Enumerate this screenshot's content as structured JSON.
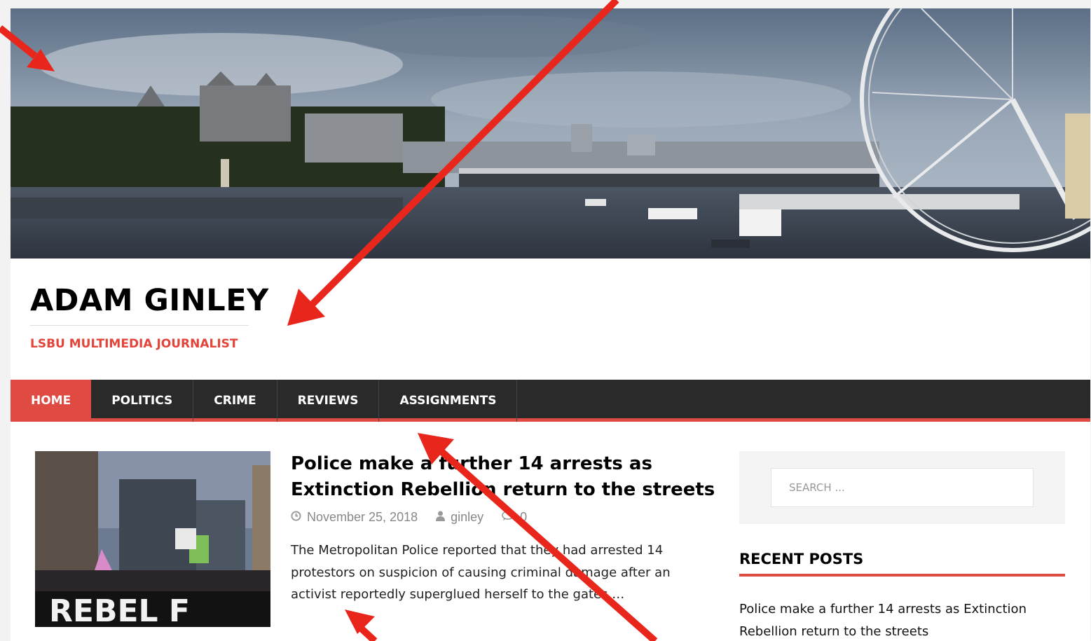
{
  "site": {
    "title": "ADAM GINLEY",
    "tagline": "LSBU MULTIMEDIA JOURNALIST"
  },
  "nav": {
    "items": [
      {
        "label": "HOME",
        "active": true
      },
      {
        "label": "POLITICS",
        "active": false
      },
      {
        "label": "CRIME",
        "active": false
      },
      {
        "label": "REVIEWS",
        "active": false
      },
      {
        "label": "ASSIGNMENTS",
        "active": false
      }
    ]
  },
  "post": {
    "title": "Police make a further 14 arrests as Extinction Rebellion return to the streets",
    "date": "November 25, 2018",
    "author": "ginley",
    "comments": "0",
    "excerpt": "The Metropolitan Police reported that they had arrested 14 protestors on suspicion of causing criminal damage after an activist reportedly superglued herself to the gates …",
    "thumb_banner_text": "REBEL F"
  },
  "sidebar": {
    "search_placeholder": "SEARCH ...",
    "recent_title": "RECENT POSTS",
    "recent_posts": [
      "Police make a further 14 arrests as Extinction Rebellion return to the streets"
    ]
  },
  "colors": {
    "accent": "#df4a43",
    "nav_bg": "#2a2a2a",
    "annotation": "#e8261c"
  },
  "icons": {
    "date": "clock-icon",
    "author": "user-icon",
    "comments": "comment-icon"
  }
}
